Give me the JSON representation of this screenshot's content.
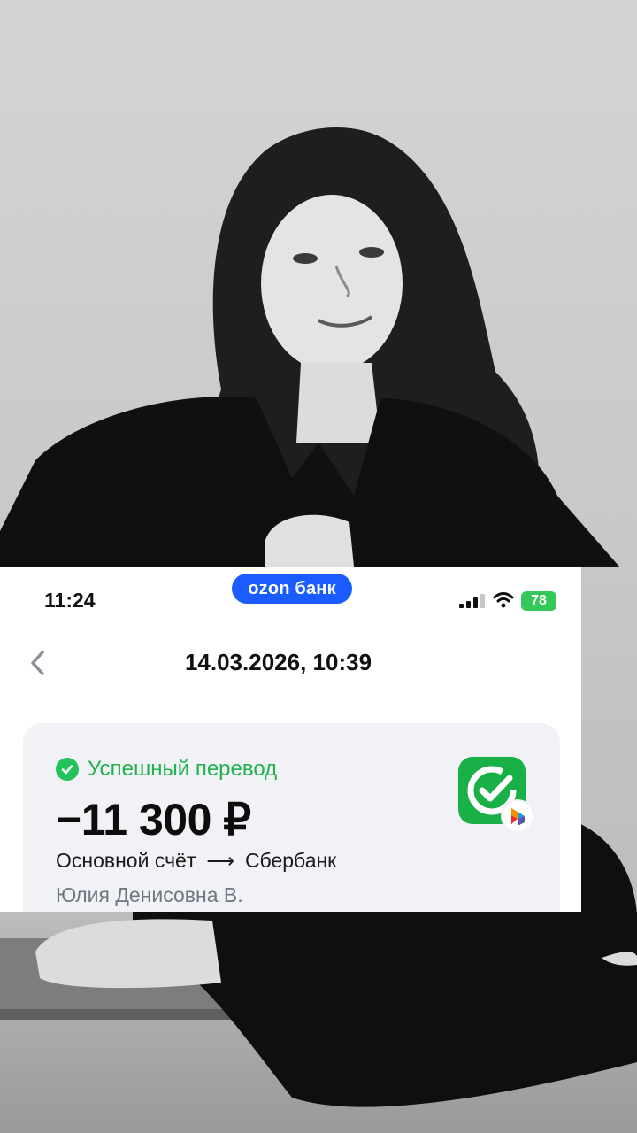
{
  "status_bar": {
    "time": "11:24",
    "app_badge": "ozon банк",
    "battery": "78"
  },
  "nav": {
    "back_icon": "chevron-left-icon",
    "title": "14.03.2026, 10:39"
  },
  "transaction": {
    "status": "Успешный перевод",
    "amount": "−11 300 ₽",
    "from_account": "Основной счёт",
    "arrow": "⟶",
    "to_bank": "Сбербанк",
    "recipient": "Юлия Денисовна В.",
    "bank_icon": "sberbank-logo-icon",
    "transfer_system_icon": "sbp-icon"
  },
  "colors": {
    "ozon_brand": "#1a5cff",
    "success": "#21c35a",
    "sber_green": "#19b047",
    "battery": "#34c759"
  }
}
